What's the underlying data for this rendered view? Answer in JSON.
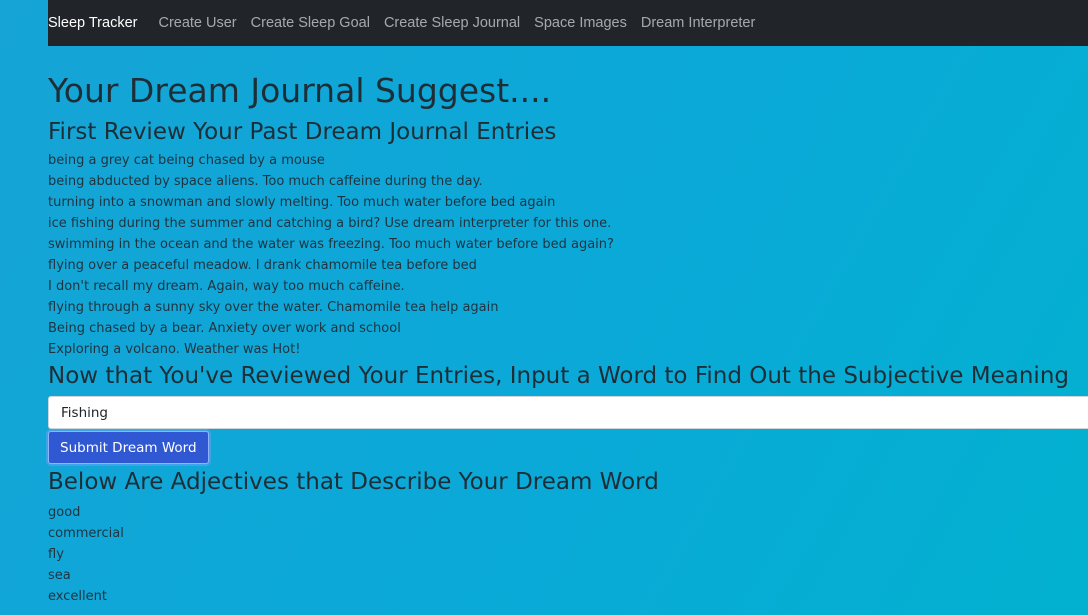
{
  "nav": {
    "brand": "Sleep Tracker",
    "links": [
      "Create User",
      "Create Sleep Goal",
      "Create Sleep Journal",
      "Space Images",
      "Dream Interpreter"
    ]
  },
  "main": {
    "title": "Your Dream Journal Suggest....",
    "review_heading": "First Review Your Past Dream Journal Entries",
    "entries": [
      "being a grey cat being chased by a mouse",
      "being abducted by space aliens. Too much caffeine during the day.",
      "turning into a snowman and slowly melting. Too much water before bed again",
      "ice fishing during the summer and catching a bird? Use dream interpreter for this one.",
      "swimming in the ocean and the water was freezing. Too much water before bed again?",
      "flying over a peaceful meadow. I drank chamomile tea before bed",
      "I don't recall my dream. Again, way too much caffeine.",
      "flying through a sunny sky over the water. Chamomile tea help again",
      "Being chased by a bear. Anxiety over work and school",
      "Exploring a volcano. Weather was Hot!"
    ],
    "input_heading": "Now that You've Reviewed Your Entries, Input a Word to Find Out the Subjective Meaning",
    "input_value": "Fishing",
    "submit_label": "Submit Dream Word",
    "adjectives_heading": "Below Are Adjectives that Describe Your Dream Word",
    "adjectives": [
      "good",
      "commercial",
      "fly",
      "sea",
      "excellent"
    ]
  },
  "colors": {
    "navbar": "#212529",
    "background_start": "#16a4d6",
    "background_end": "#02b1cf",
    "button": "#2f58d2"
  }
}
